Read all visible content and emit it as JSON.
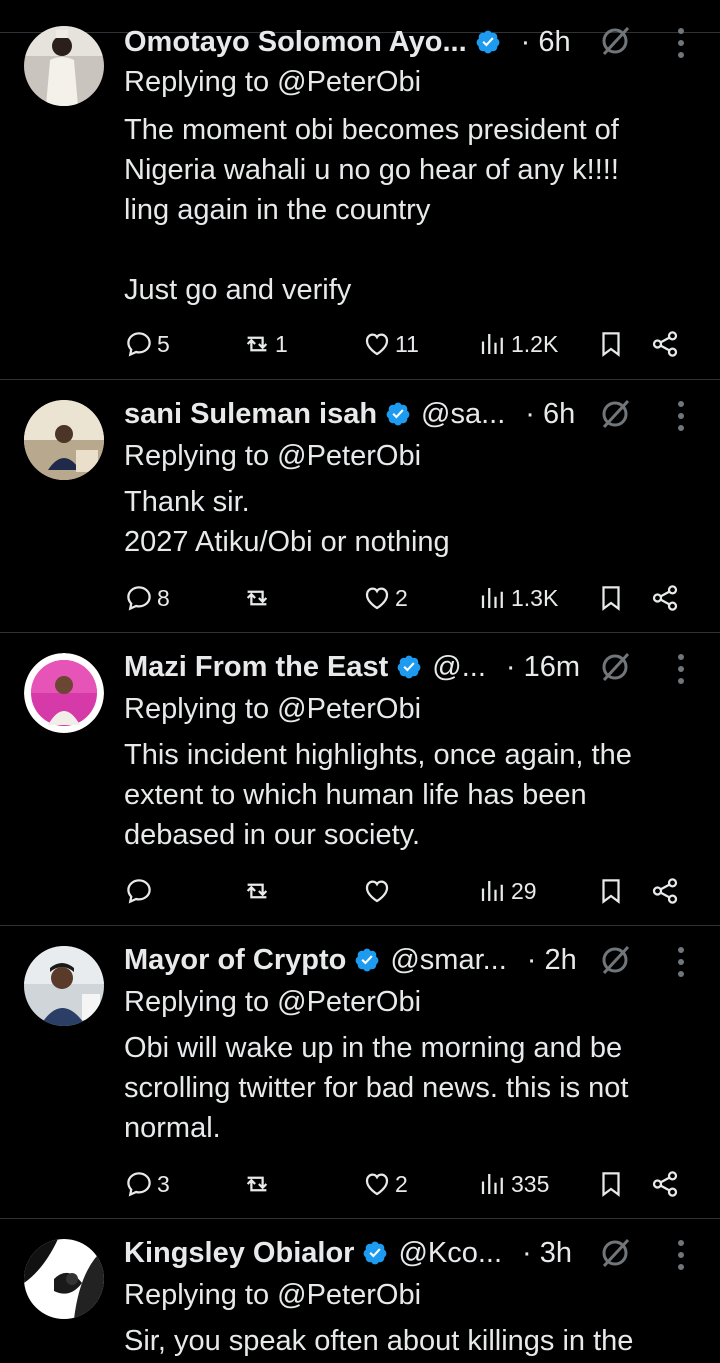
{
  "replies": [
    {
      "name": "Omotayo Solomon Ayo...",
      "handle": "",
      "time": "· 6h",
      "replying_to": "Replying to @PeterObi",
      "text": "The moment obi becomes president of\nNigeria wahali u no go hear of any k!!!!\nling again in the country\n\nJust go and verify",
      "stats": {
        "replies": "5",
        "reposts": "1",
        "likes": "11",
        "views": "1.2K"
      }
    },
    {
      "name": "sani Suleman isah",
      "handle": "@sa...",
      "time": "· 6h",
      "replying_to": "Replying to @PeterObi",
      "text": "Thank sir.\n2027 Atiku/Obi or nothing",
      "stats": {
        "replies": "8",
        "reposts": "",
        "likes": "2",
        "views": "1.3K"
      }
    },
    {
      "name": "Mazi From the East",
      "handle": "@...",
      "time": "· 16m",
      "replying_to": "Replying to @PeterObi",
      "text": "This incident highlights, once again, the\nextent to which human life has been\ndebased in our society.",
      "stats": {
        "replies": "",
        "reposts": "",
        "likes": "",
        "views": "29"
      }
    },
    {
      "name": "Mayor of Crypto",
      "handle": "@smar...",
      "time": "· 2h",
      "replying_to": "Replying to @PeterObi",
      "text": "Obi will wake up in the morning and be\nscrolling twitter for bad news. this is not\nnormal.",
      "stats": {
        "replies": "3",
        "reposts": "",
        "likes": "2",
        "views": "335"
      }
    },
    {
      "name": "Kingsley Obialor",
      "handle": "@Kco...",
      "time": "· 3h",
      "replying_to": "Replying to @PeterObi",
      "text": "Sir, you speak often about killings in the",
      "stats": {
        "replies": "",
        "reposts": "",
        "likes": "",
        "views": ""
      }
    }
  ],
  "colors": {
    "background": "#000000",
    "text": "#e7e9ea",
    "verified": "#1d9bf0",
    "divider": "#2f3336"
  },
  "icons": [
    "reply-icon",
    "repost-icon",
    "like-icon",
    "views-icon",
    "bookmark-icon",
    "share-icon",
    "grok-icon",
    "more-icon",
    "verified-badge-icon"
  ]
}
